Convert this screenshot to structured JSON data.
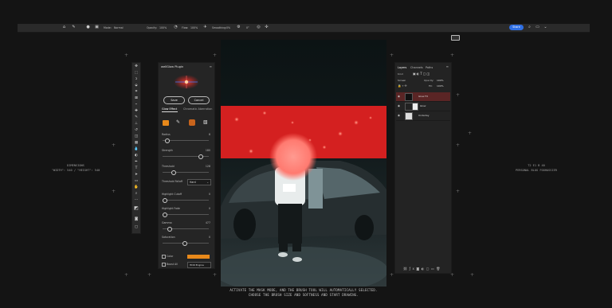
{
  "options_bar": {
    "mode_label": "Mode:",
    "mode_value": "Normal",
    "opacity_label": "Opacity:",
    "opacity_value": "100%",
    "flow_label": "Flow:",
    "flow_value": "100%",
    "smoothing_label": "Smoothing:",
    "smoothing_value": "0%",
    "angle_value": "0°",
    "share_label": "Share"
  },
  "plugin": {
    "title": "wellGlow Plugin",
    "save_label": "Save",
    "cancel_label": "Cancel",
    "tabs": [
      "Glow Effect",
      "Chromatic Aberration"
    ],
    "sliders": [
      {
        "label": "Radius",
        "value": "8",
        "level": 0.05
      },
      {
        "label": "Strength",
        "value": "180",
        "level": 0.8
      },
      {
        "label": "Threshold",
        "value": "128",
        "level": 0.2
      }
    ],
    "threshold_falloff_label": "Threshold Falloff",
    "threshold_falloff_value": "Hard",
    "sliders2": [
      {
        "label": "Highlight Cutoff",
        "value": "0",
        "level": 0.0
      },
      {
        "label": "Highlight Fade",
        "value": "0",
        "level": 0.0
      },
      {
        "label": "Gamma",
        "value": "477",
        "level": 0.1
      },
      {
        "label": "Saturation",
        "value": "0",
        "level": 0.45
      }
    ],
    "color_label": "Color",
    "color_hex": "#e8891a",
    "boost_label": "Boost All",
    "boost_value": "HDR Engine"
  },
  "layers_panel": {
    "tabs": [
      "Layers",
      "Channels",
      "Paths"
    ],
    "kind_label": "Kind",
    "blend_mode": "Screen",
    "opacity_label": "Opacity:",
    "opacity_value": "100%",
    "fill_label": "Fill:",
    "fill_value": "100%",
    "layers": [
      {
        "name": "Glow FX",
        "selected": true
      },
      {
        "name": "Glow",
        "selected": false
      },
      {
        "name": "Underlay",
        "selected": false
      }
    ]
  },
  "left_caption": {
    "line1": "DIMENSIONS",
    "line2": "\"WIDTH\": 540 / \"HEIGHT\": 540"
  },
  "right_caption": {
    "line1": "T2 E1 B 40",
    "line2": "PERSONAL BLOG FOOHASSIER"
  },
  "subtitle": {
    "line1": "ACTIVATE THE MASK MODE, AND THE BRUSH TOOL WILL AUTOMATICALLY SELECTED.",
    "line2": "CHOOSE THE BRUSH SIZE AND SOFTNESS AND START DRAWING."
  },
  "colors": {
    "mask_red": "#d42020",
    "accent_orange": "#e8891a",
    "share_blue": "#2f6fe4",
    "selected_layer": "#5a2525"
  }
}
